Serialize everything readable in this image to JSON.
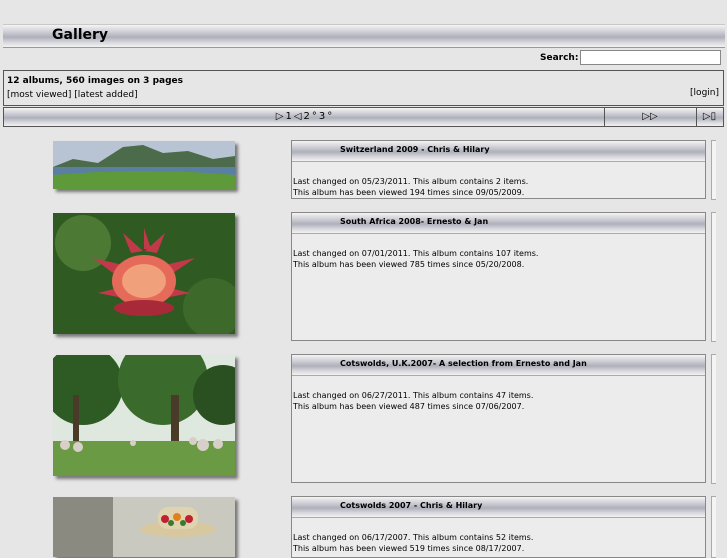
{
  "header": {
    "title": "Gallery"
  },
  "search": {
    "label": "Search:",
    "value": ""
  },
  "info": {
    "summary": "12 albums, 560 images on 3 pages",
    "most_viewed": "[most viewed]",
    "latest_added": "[latest added]",
    "login": "[login]"
  },
  "nav": {
    "prev_icon": "▷",
    "page1": "1",
    "back_icon": "◁",
    "page2": "2",
    "sep1": "°",
    "page3": "3",
    "sep2": "°",
    "next_label": "▷▷",
    "last_label": "▷▯"
  },
  "albums": [
    {
      "title": "Switzerland 2009 - Chris & Hilary",
      "line1": "Last changed on 05/23/2011. This album contains 2 items.",
      "line2": "This album has been viewed 194 times since 09/05/2009."
    },
    {
      "title": "South Africa 2008- Ernesto & Jan",
      "line1": "Last changed on 07/01/2011. This album contains 107 items.",
      "line2": "This album has been viewed 785 times since 05/20/2008."
    },
    {
      "title": "Cotswolds, U.K.2007- A selection from Ernesto and Jan",
      "line1": "Last changed on 06/27/2011. This album contains 47 items.",
      "line2": "This album has been viewed 487 times since 07/06/2007."
    },
    {
      "title": "Cotswolds 2007 - Chris & Hilary",
      "line1": "Last changed on 06/17/2007. This album contains 52 items.",
      "line2": "This album has been viewed 519 times since 08/17/2007."
    }
  ],
  "colors": {
    "bar_mid": "#aeb0ba",
    "page_bg": "#e6e6e6"
  }
}
